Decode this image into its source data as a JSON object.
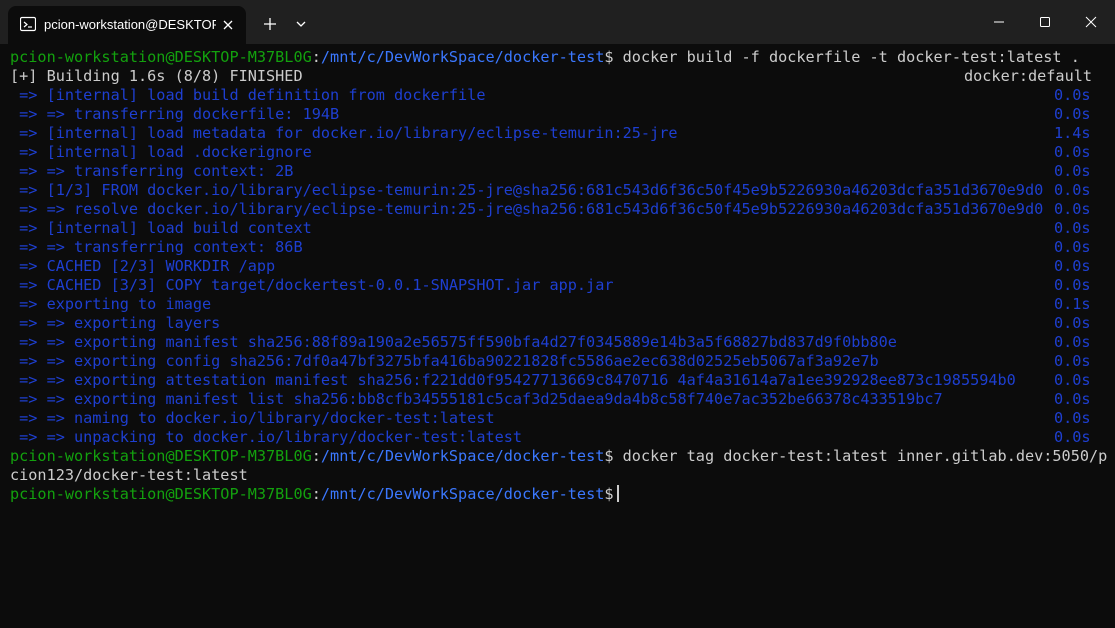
{
  "tab": {
    "title": "pcion-workstation@DESKTOP-",
    "icon": "terminal-icon"
  },
  "window_controls": {
    "new_tab_icon": "plus-icon",
    "dropdown_icon": "chevron-down-icon",
    "minimize_icon": "minimize-icon",
    "maximize_icon": "maximize-icon",
    "close_icon": "close-icon"
  },
  "colors": {
    "background": "#0c0c0c",
    "titlebar": "#202020",
    "prompt_user": "#13a10e",
    "prompt_path": "#3b78ff",
    "text": "#cccccc",
    "build_step": "#1e3fd1"
  },
  "prompt": {
    "user": "pcion-workstation@DESKTOP-M37BL0G",
    "sep": ":",
    "path": "/mnt/c/DevWorkSpace/docker-test",
    "symbol": "$"
  },
  "commands": {
    "build": " docker build -f dockerfile -t docker-test:latest .",
    "tag_part1": " docker tag docker-test:latest inner.gitlab.dev:5050/p",
    "tag_part2": "cion123/docker-test:latest"
  },
  "build_header": {
    "status": "[+] Building 1.6s (8/8) FINISHED",
    "context": "docker:default"
  },
  "build_steps": [
    {
      "text": " => [internal] load build definition from dockerfile",
      "time": "0.0s"
    },
    {
      "text": " => => transferring dockerfile: 194B",
      "time": "0.0s"
    },
    {
      "text": " => [internal] load metadata for docker.io/library/eclipse-temurin:25-jre",
      "time": "1.4s"
    },
    {
      "text": " => [internal] load .dockerignore",
      "time": "0.0s"
    },
    {
      "text": " => => transferring context: 2B",
      "time": "0.0s"
    },
    {
      "text": " => [1/3] FROM docker.io/library/eclipse-temurin:25-jre@sha256:681c543d6f36c50f45e9b5226930a46203dcfa351d3670e9d0",
      "time": "0.0s"
    },
    {
      "text": " => => resolve docker.io/library/eclipse-temurin:25-jre@sha256:681c543d6f36c50f45e9b5226930a46203dcfa351d3670e9d0",
      "time": "0.0s"
    },
    {
      "text": " => [internal] load build context",
      "time": "0.0s"
    },
    {
      "text": " => => transferring context: 86B",
      "time": "0.0s"
    },
    {
      "text": " => CACHED [2/3] WORKDIR /app",
      "time": "0.0s"
    },
    {
      "text": " => CACHED [3/3] COPY target/dockertest-0.0.1-SNAPSHOT.jar app.jar",
      "time": "0.0s"
    },
    {
      "text": " => exporting to image",
      "time": "0.1s"
    },
    {
      "text": " => => exporting layers",
      "time": "0.0s"
    },
    {
      "text": " => => exporting manifest sha256:88f89a190a2e56575ff590bfa4d27f0345889e14b3a5f68827bd837d9f0bb80e",
      "time": "0.0s"
    },
    {
      "text": " => => exporting config sha256:7df0a47bf3275bfa416ba90221828fc5586ae2ec638d02525eb5067af3a92e7b",
      "time": "0.0s"
    },
    {
      "text": " => => exporting attestation manifest sha256:f221dd0f95427713669c8470716 4af4a31614a7a1ee392928ee873c1985594b0",
      "time": "0.0s"
    },
    {
      "text": " => => exporting manifest list sha256:bb8cfb34555181c5caf3d25daea9da4b8c58f740e7ac352be66378c433519bc7",
      "time": "0.0s"
    },
    {
      "text": " => => naming to docker.io/library/docker-test:latest",
      "time": "0.0s"
    },
    {
      "text": " => => unpacking to docker.io/library/docker-test:latest",
      "time": "0.0s"
    }
  ]
}
